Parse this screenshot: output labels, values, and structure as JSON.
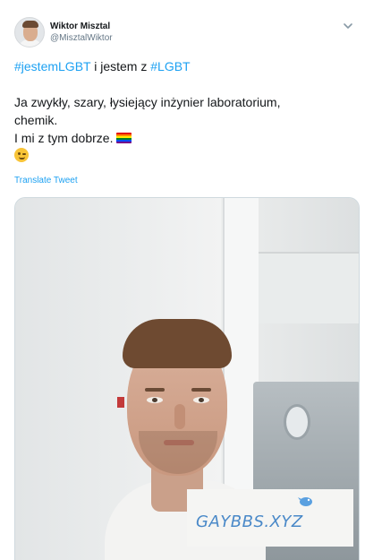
{
  "author": {
    "display_name": "Wiktor Misztal",
    "handle": "@MisztalWiktor"
  },
  "tweet": {
    "hashtag1": "#jestemLGBT",
    "middle_text": " i jestem z ",
    "hashtag2": "#LGBT",
    "line2": "Ja zwykły, szary, łysiejący inżynier laboratorium,",
    "line3": "chemik.",
    "line4": "I mi z tym dobrze.",
    "emoji_flag": "rainbow-flag-icon",
    "emoji_wink": "winking-face-icon"
  },
  "actions": {
    "translate_label": "Translate Tweet"
  },
  "media": {
    "watermark_text": "GAYBBS.XYZ"
  },
  "colors": {
    "link": "#1da1f2",
    "text": "#14171a",
    "secondary": "#657786",
    "watermark": "#4a89c8"
  }
}
